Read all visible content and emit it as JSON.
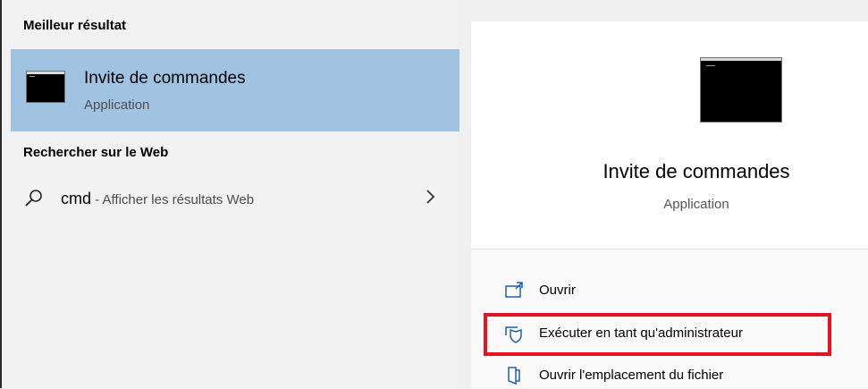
{
  "left_panel": {
    "best_result_heading": "Meilleur résultat",
    "best_result": {
      "title": "Invite de commandes",
      "subtitle": "Application",
      "icon": "command-prompt-icon"
    },
    "web_heading": "Rechercher sur le Web",
    "web_result": {
      "query": "cmd",
      "separator": " - ",
      "description": "Afficher les résultats Web",
      "icon": "search-icon",
      "chevron_icon": "chevron-right-icon"
    }
  },
  "right_panel": {
    "app_title": "Invite de commandes",
    "app_subtitle": "Application",
    "actions": [
      {
        "label": "Ouvrir",
        "icon": "open-icon"
      },
      {
        "label": "Exécuter en tant qu'administrateur",
        "icon": "run-as-admin-shield-icon"
      },
      {
        "label": "Ouvrir l'emplacement du fichier",
        "icon": "file-location-icon"
      }
    ]
  },
  "colors": {
    "selected_bg": "#9fc3e0",
    "highlight_border": "#e8111f",
    "panel_bg": "#f2f2f2",
    "details_bg": "#ffffff"
  }
}
